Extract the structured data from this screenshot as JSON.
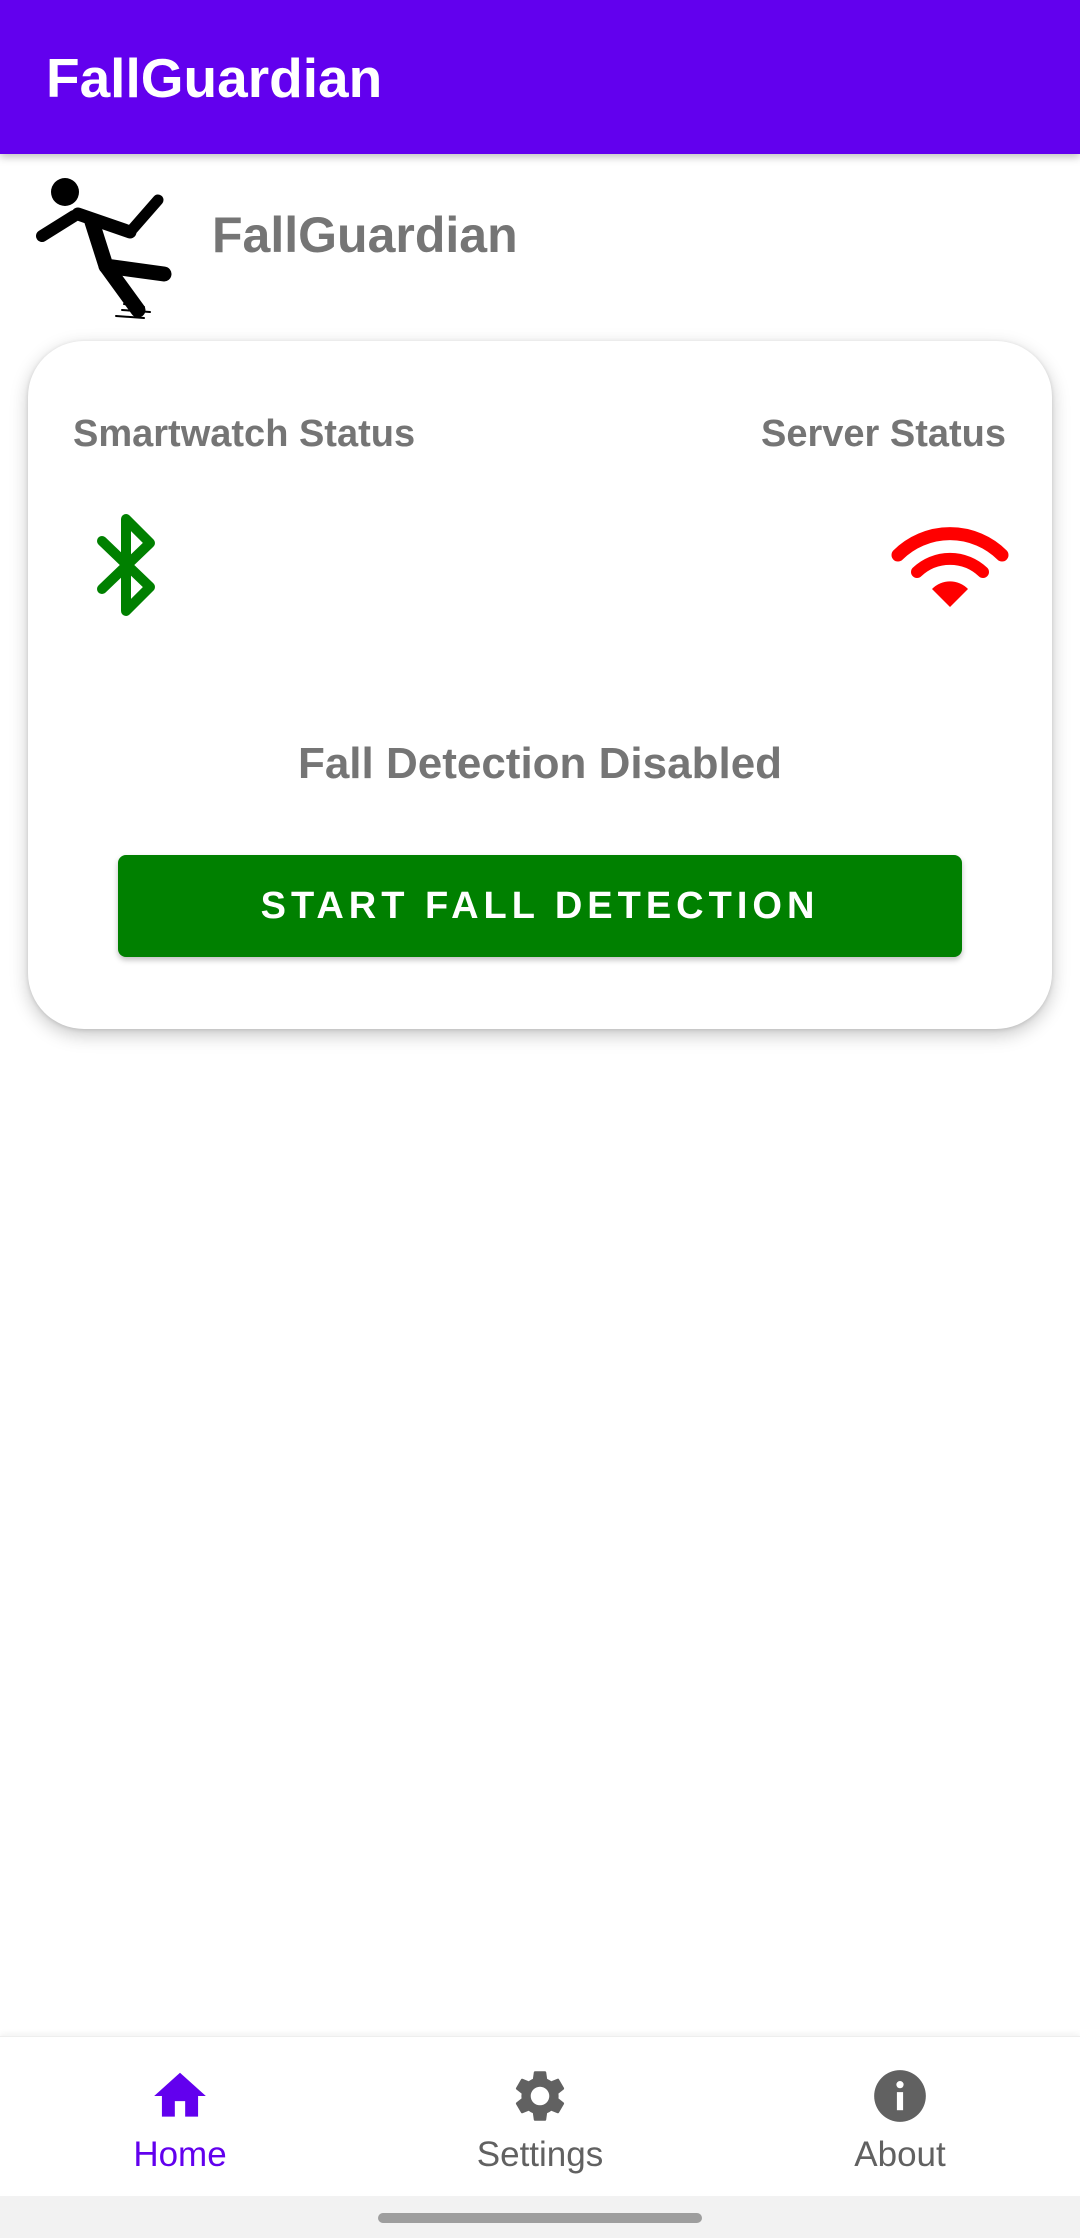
{
  "app_bar": {
    "title": "FallGuardian"
  },
  "brand": {
    "name": "FallGuardian",
    "logo_icon": "falling-person-icon"
  },
  "status_card": {
    "smartwatch_label": "Smartwatch Status",
    "server_label": "Server Status",
    "smartwatch_icon": "bluetooth-icon",
    "smartwatch_color": "#008000",
    "server_icon": "wifi-icon",
    "server_color": "#ff0000",
    "detection_status": "Fall Detection Disabled",
    "start_button_label": "START FALL DETECTION",
    "start_button_color": "#008000"
  },
  "bottom_nav": {
    "items": [
      {
        "label": "Home",
        "icon": "home-icon",
        "active": true
      },
      {
        "label": "Settings",
        "icon": "gear-icon",
        "active": false
      },
      {
        "label": "About",
        "icon": "info-icon",
        "active": false
      }
    ],
    "active_color": "#6200ee",
    "inactive_color": "#616161"
  },
  "colors": {
    "primary": "#6200ee",
    "text_secondary": "#757575"
  }
}
